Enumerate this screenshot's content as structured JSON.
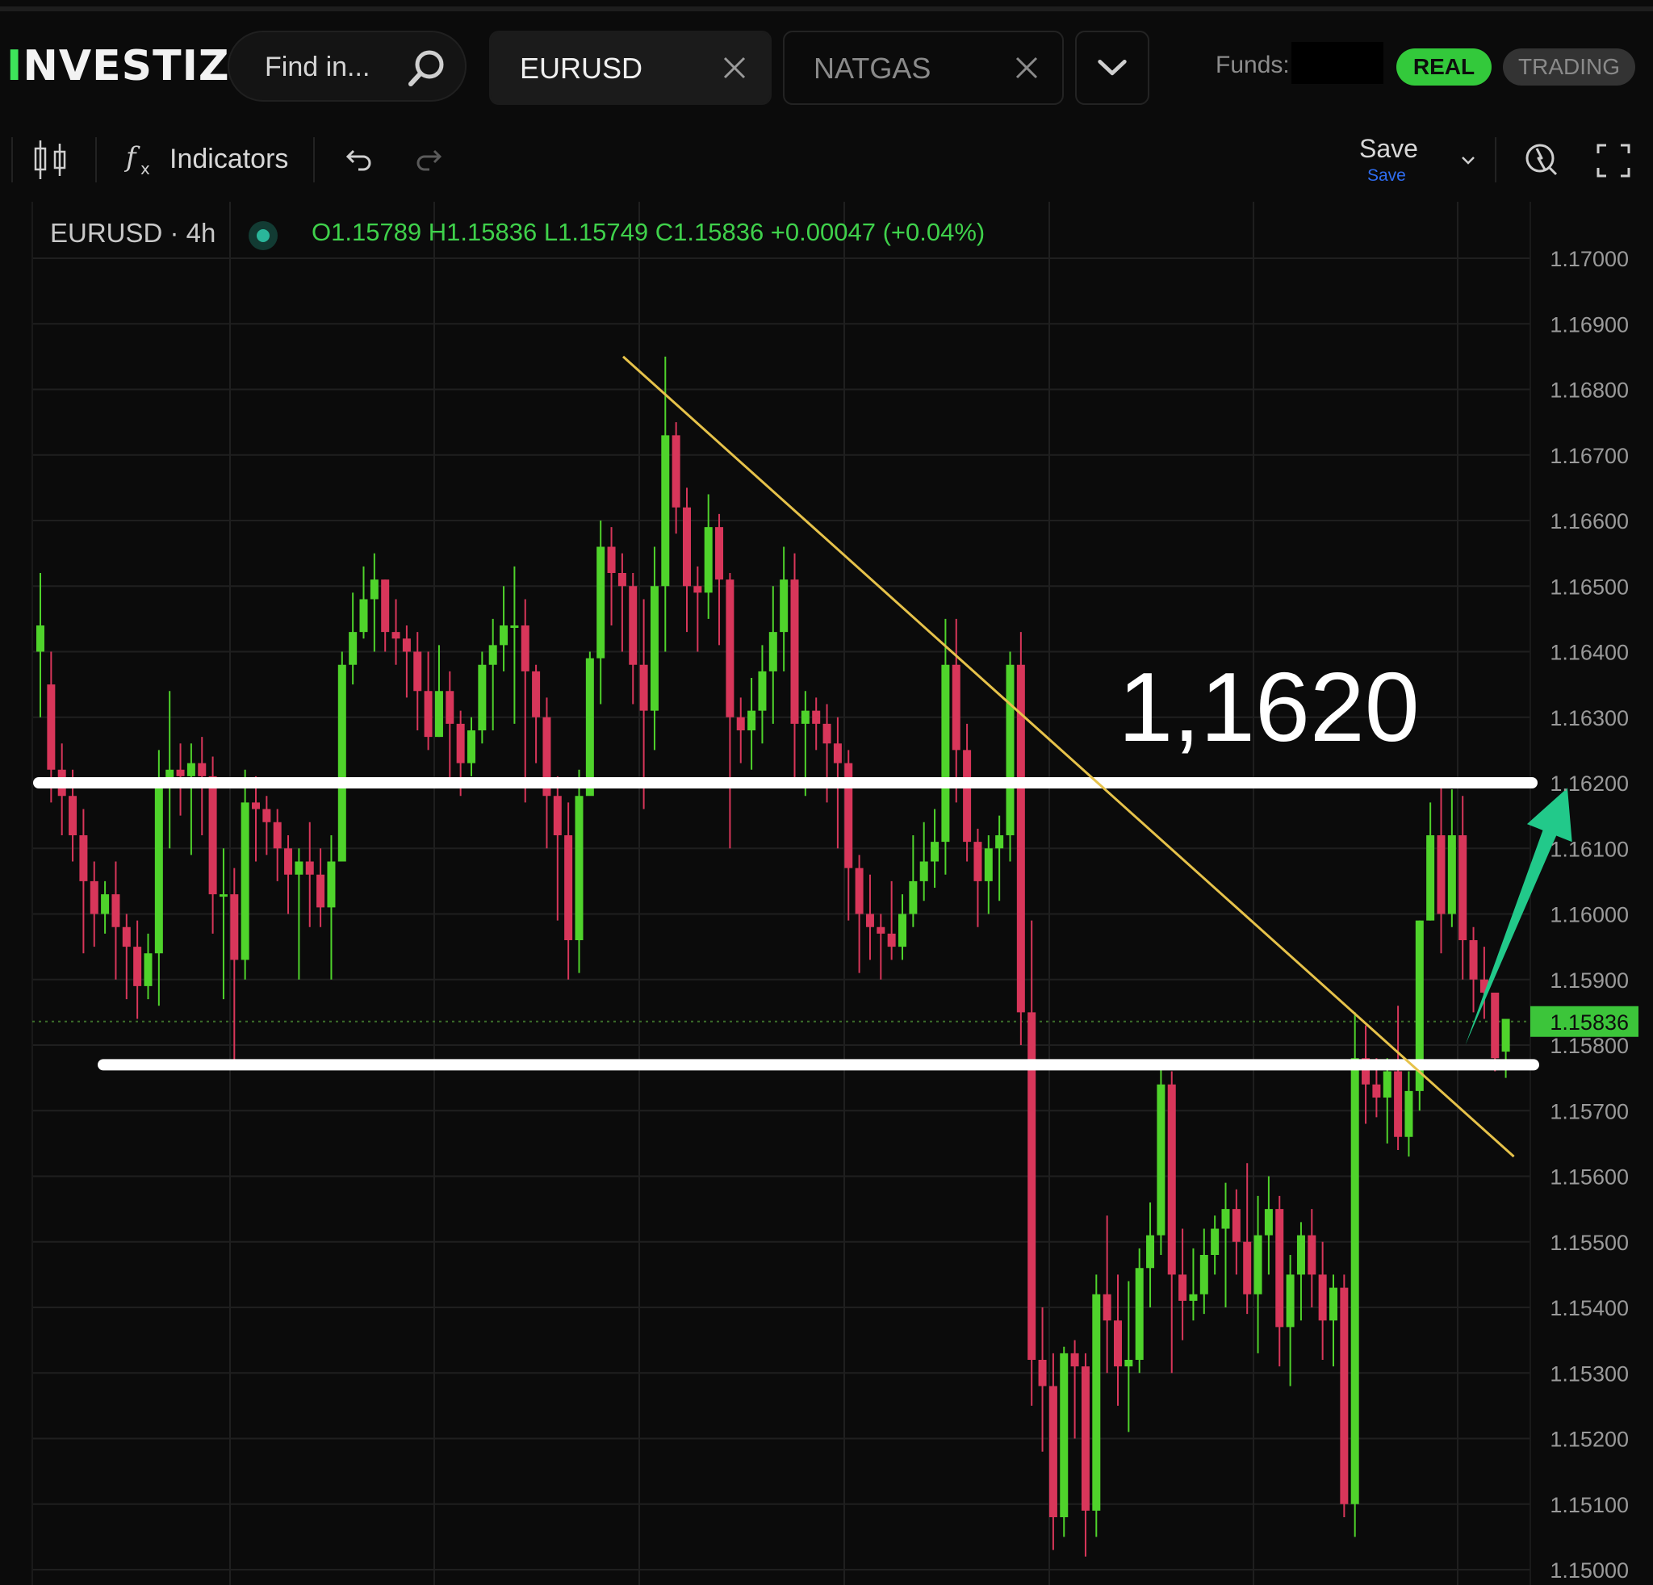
{
  "app": {
    "logo": "INVESTIZO"
  },
  "search": {
    "placeholder": "Find in..."
  },
  "tabs": [
    {
      "label": "EURUSD",
      "active": true
    },
    {
      "label": "NATGAS",
      "active": false
    }
  ],
  "account": {
    "funds_label": "Funds:",
    "mode_real": "REAL",
    "mode_trading": "TRADING"
  },
  "toolbar": {
    "indicators_label": "Indicators",
    "save_label": "Save",
    "save_sub": "Save"
  },
  "legend": {
    "symbol": "EURUSD · 4h",
    "ohlc": "O1.15789  H1.15836  L1.15749  C1.15836  +0.00047 (+0.04%)"
  },
  "colors": {
    "up": "#4fd32b",
    "down": "#d8365a",
    "accent": "#33c93b",
    "trendline": "#e6c24a",
    "arrow": "#22c98a"
  },
  "chart_data": {
    "type": "candlestick",
    "symbol": "EURUSD",
    "timeframe": "4h",
    "ylim": [
      1.15,
      1.17
    ],
    "y_ticks": [
      "1.17000",
      "1.16900",
      "1.16800",
      "1.16700",
      "1.16600",
      "1.16500",
      "1.16400",
      "1.16300",
      "1.16200",
      "1.16100",
      "1.16000",
      "1.15900",
      "1.15800",
      "1.15700",
      "1.15600",
      "1.15500",
      "1.15400",
      "1.15300",
      "1.15200",
      "1.15100",
      "1.15000"
    ],
    "last_price": "1.15836",
    "annotation_text": "1,1620",
    "support_level": 1.1577,
    "resistance_level": 1.162,
    "trendline": {
      "from": [
        0,
        1.1685
      ],
      "to": [
        136,
        1.1563
      ]
    },
    "arrow": {
      "from": [
        130,
        1.158
      ],
      "to": [
        137,
        1.1617
      ]
    },
    "candles": [
      [
        1.164,
        1.1644,
        1.163,
        1.1652
      ],
      [
        1.1635,
        1.1622,
        1.1617,
        1.164
      ],
      [
        1.1622,
        1.1618,
        1.1612,
        1.1626
      ],
      [
        1.1618,
        1.1612,
        1.1608,
        1.1622
      ],
      [
        1.1612,
        1.1605,
        1.1594,
        1.1616
      ],
      [
        1.1605,
        1.16,
        1.1595,
        1.1608
      ],
      [
        1.16,
        1.1603,
        1.1597,
        1.1605
      ],
      [
        1.1603,
        1.1598,
        1.159,
        1.1608
      ],
      [
        1.1598,
        1.1595,
        1.1587,
        1.16
      ],
      [
        1.1595,
        1.1589,
        1.1584,
        1.1599
      ],
      [
        1.1589,
        1.1594,
        1.1587,
        1.1597
      ],
      [
        1.1594,
        1.162,
        1.1586,
        1.1625
      ],
      [
        1.162,
        1.1622,
        1.161,
        1.1634
      ],
      [
        1.1622,
        1.1621,
        1.1615,
        1.1626
      ],
      [
        1.1621,
        1.1623,
        1.1609,
        1.1626
      ],
      [
        1.1623,
        1.1621,
        1.1612,
        1.1627
      ],
      [
        1.1621,
        1.1603,
        1.1597,
        1.1624
      ],
      [
        1.1603,
        1.1603,
        1.1587,
        1.161
      ],
      [
        1.1603,
        1.1593,
        1.1577,
        1.1607
      ],
      [
        1.1593,
        1.1617,
        1.159,
        1.1622
      ],
      [
        1.1617,
        1.1616,
        1.1608,
        1.1621
      ],
      [
        1.1616,
        1.1614,
        1.1609,
        1.1618
      ],
      [
        1.1614,
        1.161,
        1.1605,
        1.1616
      ],
      [
        1.161,
        1.1606,
        1.16,
        1.1612
      ],
      [
        1.1606,
        1.1608,
        1.159,
        1.161
      ],
      [
        1.1608,
        1.1606,
        1.1598,
        1.1614
      ],
      [
        1.1606,
        1.1601,
        1.1598,
        1.161
      ],
      [
        1.1601,
        1.1608,
        1.159,
        1.1612
      ],
      [
        1.1608,
        1.1638,
        1.163,
        1.164
      ],
      [
        1.1638,
        1.1643,
        1.1635,
        1.1649
      ],
      [
        1.1643,
        1.1648,
        1.1642,
        1.1653
      ],
      [
        1.1648,
        1.1651,
        1.164,
        1.1655
      ],
      [
        1.1651,
        1.1643,
        1.164,
        1.1651
      ],
      [
        1.1643,
        1.1642,
        1.1638,
        1.1648
      ],
      [
        1.1642,
        1.164,
        1.1633,
        1.1644
      ],
      [
        1.164,
        1.1634,
        1.1628,
        1.1643
      ],
      [
        1.1634,
        1.1627,
        1.1625,
        1.164
      ],
      [
        1.1627,
        1.1634,
        1.1627,
        1.1641
      ],
      [
        1.1634,
        1.1629,
        1.162,
        1.1637
      ],
      [
        1.1629,
        1.1623,
        1.1618,
        1.1631
      ],
      [
        1.1623,
        1.1628,
        1.1621,
        1.163
      ],
      [
        1.1628,
        1.1638,
        1.1626,
        1.164
      ],
      [
        1.1638,
        1.1641,
        1.1628,
        1.1645
      ],
      [
        1.1641,
        1.1644,
        1.1637,
        1.165
      ],
      [
        1.1644,
        1.1644,
        1.1629,
        1.1653
      ],
      [
        1.1644,
        1.1637,
        1.1617,
        1.1648
      ],
      [
        1.1637,
        1.163,
        1.1623,
        1.1638
      ],
      [
        1.163,
        1.1618,
        1.161,
        1.1633
      ],
      [
        1.1618,
        1.1612,
        1.1599,
        1.1621
      ],
      [
        1.1612,
        1.1596,
        1.159,
        1.1617
      ],
      [
        1.1596,
        1.1618,
        1.1591,
        1.1622
      ],
      [
        1.1618,
        1.1639,
        1.1622,
        1.164
      ],
      [
        1.1639,
        1.1656,
        1.1632,
        1.166
      ],
      [
        1.1656,
        1.1652,
        1.1644,
        1.1659
      ],
      [
        1.1652,
        1.165,
        1.164,
        1.1655
      ],
      [
        1.165,
        1.1638,
        1.1632,
        1.1652
      ],
      [
        1.1638,
        1.1631,
        1.1616,
        1.1648
      ],
      [
        1.1631,
        1.165,
        1.1625,
        1.1656
      ],
      [
        1.165,
        1.1673,
        1.164,
        1.1685
      ],
      [
        1.1673,
        1.1662,
        1.1658,
        1.1675
      ],
      [
        1.1662,
        1.165,
        1.1643,
        1.1665
      ],
      [
        1.165,
        1.1649,
        1.164,
        1.1653
      ],
      [
        1.1649,
        1.1659,
        1.1645,
        1.1664
      ],
      [
        1.1659,
        1.1651,
        1.1641,
        1.1661
      ],
      [
        1.1651,
        1.163,
        1.161,
        1.1652
      ],
      [
        1.163,
        1.1628,
        1.1623,
        1.1633
      ],
      [
        1.1628,
        1.1631,
        1.1622,
        1.1636
      ],
      [
        1.1631,
        1.1637,
        1.1626,
        1.1641
      ],
      [
        1.1637,
        1.1643,
        1.1629,
        1.165
      ],
      [
        1.1643,
        1.1651,
        1.1637,
        1.1656
      ],
      [
        1.1651,
        1.1629,
        1.162,
        1.1655
      ],
      [
        1.1629,
        1.1631,
        1.1618,
        1.1634
      ],
      [
        1.1631,
        1.1629,
        1.1625,
        1.1633
      ],
      [
        1.1629,
        1.1626,
        1.1617,
        1.1632
      ],
      [
        1.1626,
        1.1623,
        1.161,
        1.163
      ],
      [
        1.1623,
        1.1607,
        1.1599,
        1.1625
      ],
      [
        1.1607,
        1.16,
        1.1591,
        1.1609
      ],
      [
        1.16,
        1.1598,
        1.1593,
        1.1606
      ],
      [
        1.1598,
        1.1597,
        1.159,
        1.16
      ],
      [
        1.1597,
        1.1595,
        1.1593,
        1.1605
      ],
      [
        1.1595,
        1.16,
        1.1593,
        1.1603
      ],
      [
        1.16,
        1.1605,
        1.1598,
        1.1612
      ],
      [
        1.1605,
        1.1608,
        1.1602,
        1.1614
      ],
      [
        1.1608,
        1.1611,
        1.1604,
        1.1616
      ],
      [
        1.1611,
        1.1638,
        1.1606,
        1.1645
      ],
      [
        1.1638,
        1.1625,
        1.1617,
        1.1645
      ],
      [
        1.1625,
        1.1611,
        1.1608,
        1.1629
      ],
      [
        1.1611,
        1.1605,
        1.1598,
        1.1613
      ],
      [
        1.1605,
        1.161,
        1.16,
        1.1612
      ],
      [
        1.161,
        1.1612,
        1.1602,
        1.1615
      ],
      [
        1.1612,
        1.1638,
        1.1608,
        1.164
      ],
      [
        1.1638,
        1.1585,
        1.158,
        1.1643
      ],
      [
        1.1585,
        1.1532,
        1.1525,
        1.1599
      ],
      [
        1.1532,
        1.1528,
        1.1518,
        1.154
      ],
      [
        1.1528,
        1.1508,
        1.1503,
        1.1533
      ],
      [
        1.1508,
        1.1533,
        1.1505,
        1.1534
      ],
      [
        1.1533,
        1.1531,
        1.152,
        1.1535
      ],
      [
        1.1531,
        1.1509,
        1.1502,
        1.1533
      ],
      [
        1.1509,
        1.1542,
        1.1505,
        1.1545
      ],
      [
        1.1542,
        1.1538,
        1.153,
        1.1554
      ],
      [
        1.1538,
        1.1531,
        1.1525,
        1.1545
      ],
      [
        1.1531,
        1.1532,
        1.1521,
        1.1544
      ],
      [
        1.1532,
        1.1546,
        1.153,
        1.1549
      ],
      [
        1.1546,
        1.1551,
        1.154,
        1.1556
      ],
      [
        1.1551,
        1.1574,
        1.1548,
        1.1577
      ],
      [
        1.1574,
        1.1545,
        1.153,
        1.1576
      ],
      [
        1.1545,
        1.1541,
        1.1535,
        1.1552
      ],
      [
        1.1541,
        1.1542,
        1.1538,
        1.1549
      ],
      [
        1.1542,
        1.1548,
        1.1539,
        1.1552
      ],
      [
        1.1548,
        1.1552,
        1.1545,
        1.1554
      ],
      [
        1.1552,
        1.1555,
        1.154,
        1.1559
      ],
      [
        1.1555,
        1.155,
        1.1545,
        1.1558
      ],
      [
        1.155,
        1.1542,
        1.1539,
        1.1562
      ],
      [
        1.1542,
        1.1551,
        1.1533,
        1.1557
      ],
      [
        1.1551,
        1.1555,
        1.1545,
        1.156
      ],
      [
        1.1555,
        1.1537,
        1.1531,
        1.1557
      ],
      [
        1.1537,
        1.1545,
        1.1528,
        1.1548
      ],
      [
        1.1545,
        1.1551,
        1.1538,
        1.1553
      ],
      [
        1.1551,
        1.1545,
        1.154,
        1.1555
      ],
      [
        1.1545,
        1.1538,
        1.1532,
        1.155
      ],
      [
        1.1538,
        1.1543,
        1.1531,
        1.1545
      ],
      [
        1.1543,
        1.151,
        1.1508,
        1.1545
      ],
      [
        1.151,
        1.1578,
        1.1505,
        1.1585
      ],
      [
        1.1578,
        1.1574,
        1.1568,
        1.1583
      ],
      [
        1.1574,
        1.1572,
        1.1569,
        1.1578
      ],
      [
        1.1572,
        1.1576,
        1.1565,
        1.1578
      ],
      [
        1.1576,
        1.1566,
        1.1564,
        1.1586
      ],
      [
        1.1566,
        1.1573,
        1.1563,
        1.1576
      ],
      [
        1.1573,
        1.1599,
        1.157,
        1.1599
      ],
      [
        1.1599,
        1.1612,
        1.1599,
        1.1617
      ],
      [
        1.1612,
        1.16,
        1.1594,
        1.162
      ],
      [
        1.16,
        1.1612,
        1.1598,
        1.1619
      ],
      [
        1.1612,
        1.1596,
        1.159,
        1.1618
      ],
      [
        1.1596,
        1.159,
        1.1585,
        1.1598
      ],
      [
        1.159,
        1.1588,
        1.1584,
        1.1595
      ],
      [
        1.1588,
        1.1578,
        1.1576,
        1.1588
      ],
      [
        1.1579,
        1.1584,
        1.1575,
        1.1584
      ]
    ]
  }
}
